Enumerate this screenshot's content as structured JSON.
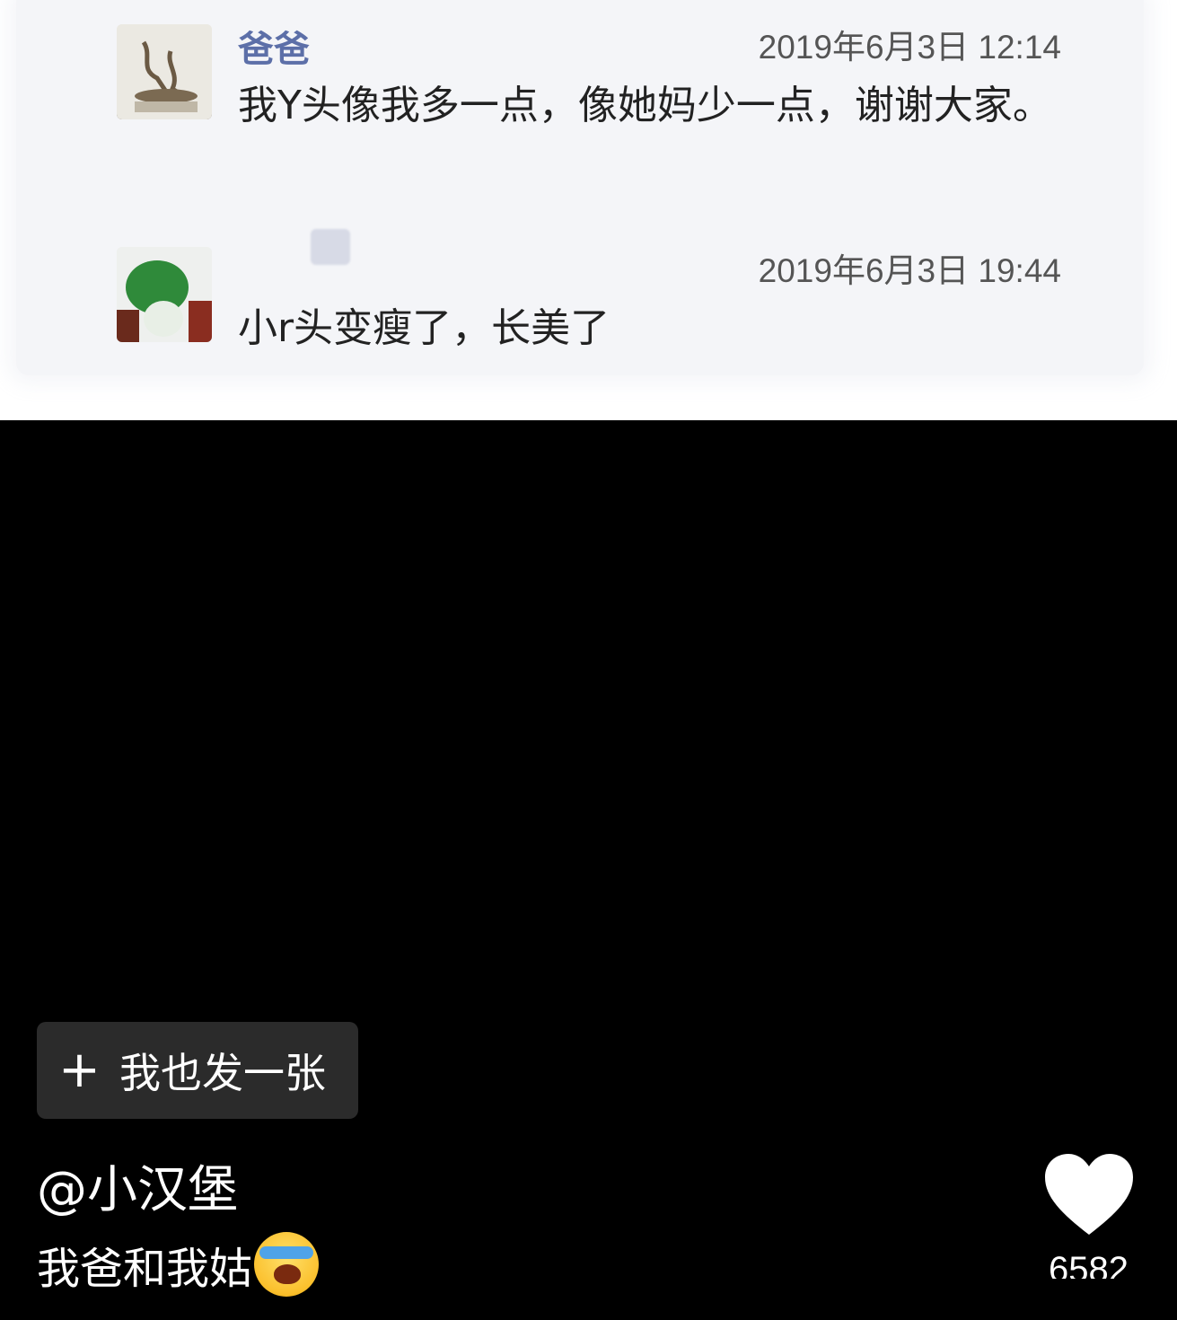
{
  "chat": {
    "messages": [
      {
        "sender": "爸爸",
        "timestamp": "2019年6月3日 12:14",
        "text": "我Y头像我多一点，像她妈少一点，谢谢大家。"
      },
      {
        "sender": "",
        "timestamp": "2019年6月3日 19:44",
        "text": "小r头变瘦了，长美了"
      }
    ]
  },
  "post_button": {
    "label": "我也发一张",
    "icon": "plus-icon"
  },
  "author": "@小汉堡",
  "caption": "我爸和我姑",
  "caption_emoji": "face-palm-laugh-emoji",
  "likes": {
    "count": "6582",
    "icon": "heart-icon",
    "color": "#ffffff"
  }
}
